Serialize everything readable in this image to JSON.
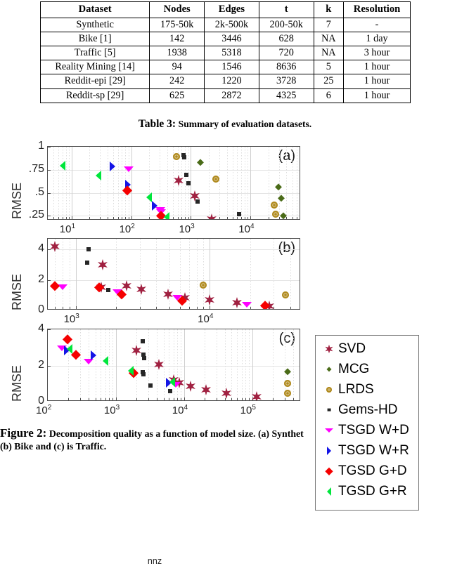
{
  "table": {
    "caption_number": "Table 3:",
    "caption_text": "Summary of evaluation datasets.",
    "columns": [
      "Dataset",
      "Nodes",
      "Edges",
      "t",
      "k",
      "Resolution"
    ],
    "rows": [
      {
        "dataset": "Synthetic",
        "nodes": "175-50k",
        "edges": "2k-500k",
        "t": "200-50k",
        "k": "7",
        "resolution": "-"
      },
      {
        "dataset": "Bike [1]",
        "nodes": "142",
        "edges": "3446",
        "t": "628",
        "k": "NA",
        "resolution": "1 day"
      },
      {
        "dataset": "Traffic [5]",
        "nodes": "1938",
        "edges": "5318",
        "t": "720",
        "k": "NA",
        "resolution": "3 hour"
      },
      {
        "dataset": "Reality Mining [14]",
        "nodes": "94",
        "edges": "1546",
        "t": "8636",
        "k": "5",
        "resolution": "1 hour"
      },
      {
        "dataset": "Reddit-epi [29]",
        "nodes": "242",
        "edges": "1220",
        "t": "3728",
        "k": "25",
        "resolution": "1 hour"
      },
      {
        "dataset": "Reddit-sp [29]",
        "nodes": "625",
        "edges": "2872",
        "t": "4325",
        "k": "6",
        "resolution": "1 hour"
      }
    ]
  },
  "figure": {
    "caption_number": "Figure 2:",
    "caption_text": "Decomposition quality as a function of model size. (a) Synthet",
    "caption_line2": "(b) Bike and (c) is Traffic.",
    "xaxis_label": "nnz"
  },
  "legend": {
    "position": "right",
    "items": [
      {
        "label": "SVD",
        "marker": "six-point-star",
        "color": "#a02040"
      },
      {
        "label": "MCG",
        "marker": "diamond-small",
        "color": "#4a6b18"
      },
      {
        "label": "LRDS",
        "marker": "circle",
        "color": "#b08a1e"
      },
      {
        "label": "Gems-HD",
        "marker": "square-small",
        "color": "#262626"
      },
      {
        "label": "TSGD W+D",
        "marker": "triangle-down",
        "color": "#ff00ff"
      },
      {
        "label": "TSGD W+R",
        "marker": "triangle-right",
        "color": "#1414e6"
      },
      {
        "label": "TGSD G+D",
        "marker": "diamond",
        "color": "#f50000"
      },
      {
        "label": "TGSD G+R",
        "marker": "triangle-left",
        "color": "#00e63c"
      }
    ]
  },
  "chart_data": [
    {
      "id": "a",
      "panel_label": "(a)",
      "type": "scatter",
      "title": "",
      "xlabel": "nnz",
      "ylabel": "RMSE",
      "xscale": "log",
      "xlim": [
        4,
        70000
      ],
      "ylim": [
        0.2,
        1.0
      ],
      "yticks": [
        1,
        0.75,
        0.5,
        0.25
      ],
      "ytick_labels": [
        "1",
        ".75",
        ".5",
        ".25"
      ],
      "xticks": [
        10,
        100,
        1000,
        10000
      ],
      "xtick_labels": [
        "10^1",
        "10^2",
        "10^3",
        "10^4"
      ],
      "grid": true,
      "series": [
        {
          "name": "SVD",
          "points": [
            [
              620,
              0.635
            ],
            [
              1150,
              0.465
            ],
            [
              2200,
              0.215
            ]
          ]
        },
        {
          "name": "MCG",
          "points": [
            [
              1450,
              0.835
            ],
            [
              29000,
              0.565
            ],
            [
              33000,
              0.445
            ],
            [
              36000,
              0.255
            ]
          ]
        },
        {
          "name": "LRDS",
          "points": [
            [
              570,
              0.895
            ],
            [
              2600,
              0.65
            ],
            [
              25000,
              0.365
            ],
            [
              26000,
              0.265
            ]
          ]
        },
        {
          "name": "Gems-HD",
          "points": [
            [
              760,
              0.905
            ],
            [
              780,
              0.885
            ],
            [
              840,
              0.695
            ],
            [
              900,
              0.605
            ],
            [
              1300,
              0.405
            ],
            [
              6500,
              0.265
            ]
          ]
        },
        {
          "name": "TSGD W+D",
          "points": [
            [
              90,
              0.755
            ],
            [
              310,
              0.315
            ],
            [
              320,
              0.295
            ]
          ]
        },
        {
          "name": "TSGD W+R",
          "points": [
            [
              48,
              0.785
            ],
            [
              88,
              0.585
            ],
            [
              250,
              0.36
            ]
          ]
        },
        {
          "name": "TGSD G+D",
          "points": [
            [
              86,
              0.525
            ],
            [
              315,
              0.255
            ]
          ]
        },
        {
          "name": "TGSD G+R",
          "points": [
            [
              7,
              0.795
            ],
            [
              28,
              0.685
            ],
            [
              200,
              0.455
            ],
            [
              390,
              0.235
            ]
          ]
        }
      ]
    },
    {
      "id": "b",
      "panel_label": "(b)",
      "type": "scatter",
      "title": "",
      "xlabel": "nnz",
      "ylabel": "RMSE",
      "xscale": "log",
      "xlim": [
        620,
        48000
      ],
      "ylim": [
        0,
        4.7
      ],
      "yticks": [
        4,
        2,
        0
      ],
      "ytick_labels": [
        "4",
        "2",
        "0"
      ],
      "xticks": [
        1000,
        10000
      ],
      "xtick_labels": [
        "10^3",
        "10^4"
      ],
      "grid": true,
      "series": [
        {
          "name": "SVD",
          "points": [
            [
              700,
              4.2
            ],
            [
              1600,
              2.98
            ],
            [
              1550,
              1.5
            ],
            [
              2400,
              1.62
            ],
            [
              3100,
              1.4
            ],
            [
              4900,
              1.08
            ],
            [
              6500,
              0.82
            ],
            [
              10000,
              0.68
            ],
            [
              16000,
              0.5
            ],
            [
              28000,
              0.28
            ]
          ]
        },
        {
          "name": "LRDS",
          "points": [
            [
              9000,
              1.66
            ],
            [
              37000,
              1.0
            ]
          ]
        },
        {
          "name": "Gems-HD",
          "points": [
            [
              1250,
              4.02
            ],
            [
              1220,
              3.12
            ],
            [
              1750,
              1.35
            ]
          ]
        },
        {
          "name": "TSGD W+D",
          "points": [
            [
              800,
              1.5
            ],
            [
              2050,
              1.22
            ],
            [
              5700,
              0.82
            ],
            [
              19000,
              0.38
            ]
          ]
        },
        {
          "name": "TGSD G+D",
          "points": [
            [
              700,
              1.62
            ],
            [
              1500,
              1.5
            ],
            [
              2200,
              1.05
            ],
            [
              6200,
              0.65
            ],
            [
              26000,
              0.3
            ]
          ]
        }
      ]
    },
    {
      "id": "c",
      "panel_label": "(c)",
      "type": "scatter",
      "title": "",
      "xlabel": "nnz",
      "ylabel": "RMSE",
      "xscale": "log",
      "xlim": [
        100,
        520000
      ],
      "ylim": [
        0,
        4
      ],
      "yticks": [
        4,
        2,
        0
      ],
      "ytick_labels": [
        "4",
        "2",
        "0"
      ],
      "xticks": [
        100,
        1000,
        10000,
        100000
      ],
      "xtick_labels": [
        "10^2",
        "10^3",
        "10^4",
        "10^5"
      ],
      "grid": true,
      "series": [
        {
          "name": "SVD",
          "points": [
            [
              2000,
              2.82
            ],
            [
              4300,
              2.05
            ],
            [
              7000,
              1.22
            ],
            [
              8500,
              1.05
            ],
            [
              12500,
              0.85
            ],
            [
              21000,
              0.65
            ],
            [
              42000,
              0.45
            ],
            [
              115000,
              0.28
            ]
          ]
        },
        {
          "name": "MCG",
          "points": [
            [
              330000,
              1.68
            ]
          ]
        },
        {
          "name": "LRDS",
          "points": [
            [
              330000,
              1.0
            ],
            [
              330000,
              0.45
            ]
          ]
        },
        {
          "name": "Gems-HD",
          "points": [
            [
              2500,
              3.35
            ],
            [
              2550,
              2.6
            ],
            [
              2600,
              2.42
            ],
            [
              2500,
              1.62
            ],
            [
              2550,
              1.5
            ],
            [
              3200,
              0.88
            ],
            [
              6200,
              0.58
            ]
          ]
        },
        {
          "name": "TSGD W+D",
          "points": [
            [
              160,
              2.95
            ],
            [
              400,
              2.2
            ],
            [
              7500,
              0.92
            ]
          ]
        },
        {
          "name": "TSGD W+R",
          "points": [
            [
              190,
              2.82
            ],
            [
              470,
              2.55
            ],
            [
              6000,
              1.05
            ]
          ]
        },
        {
          "name": "TGSD G+D",
          "points": [
            [
              195,
              3.45
            ],
            [
              260,
              2.6
            ],
            [
              1800,
              1.58
            ]
          ]
        },
        {
          "name": "TGSD G+R",
          "points": [
            [
              210,
              2.9
            ],
            [
              700,
              2.25
            ],
            [
              1650,
              1.72
            ],
            [
              6700,
              1.1
            ]
          ]
        }
      ]
    }
  ]
}
